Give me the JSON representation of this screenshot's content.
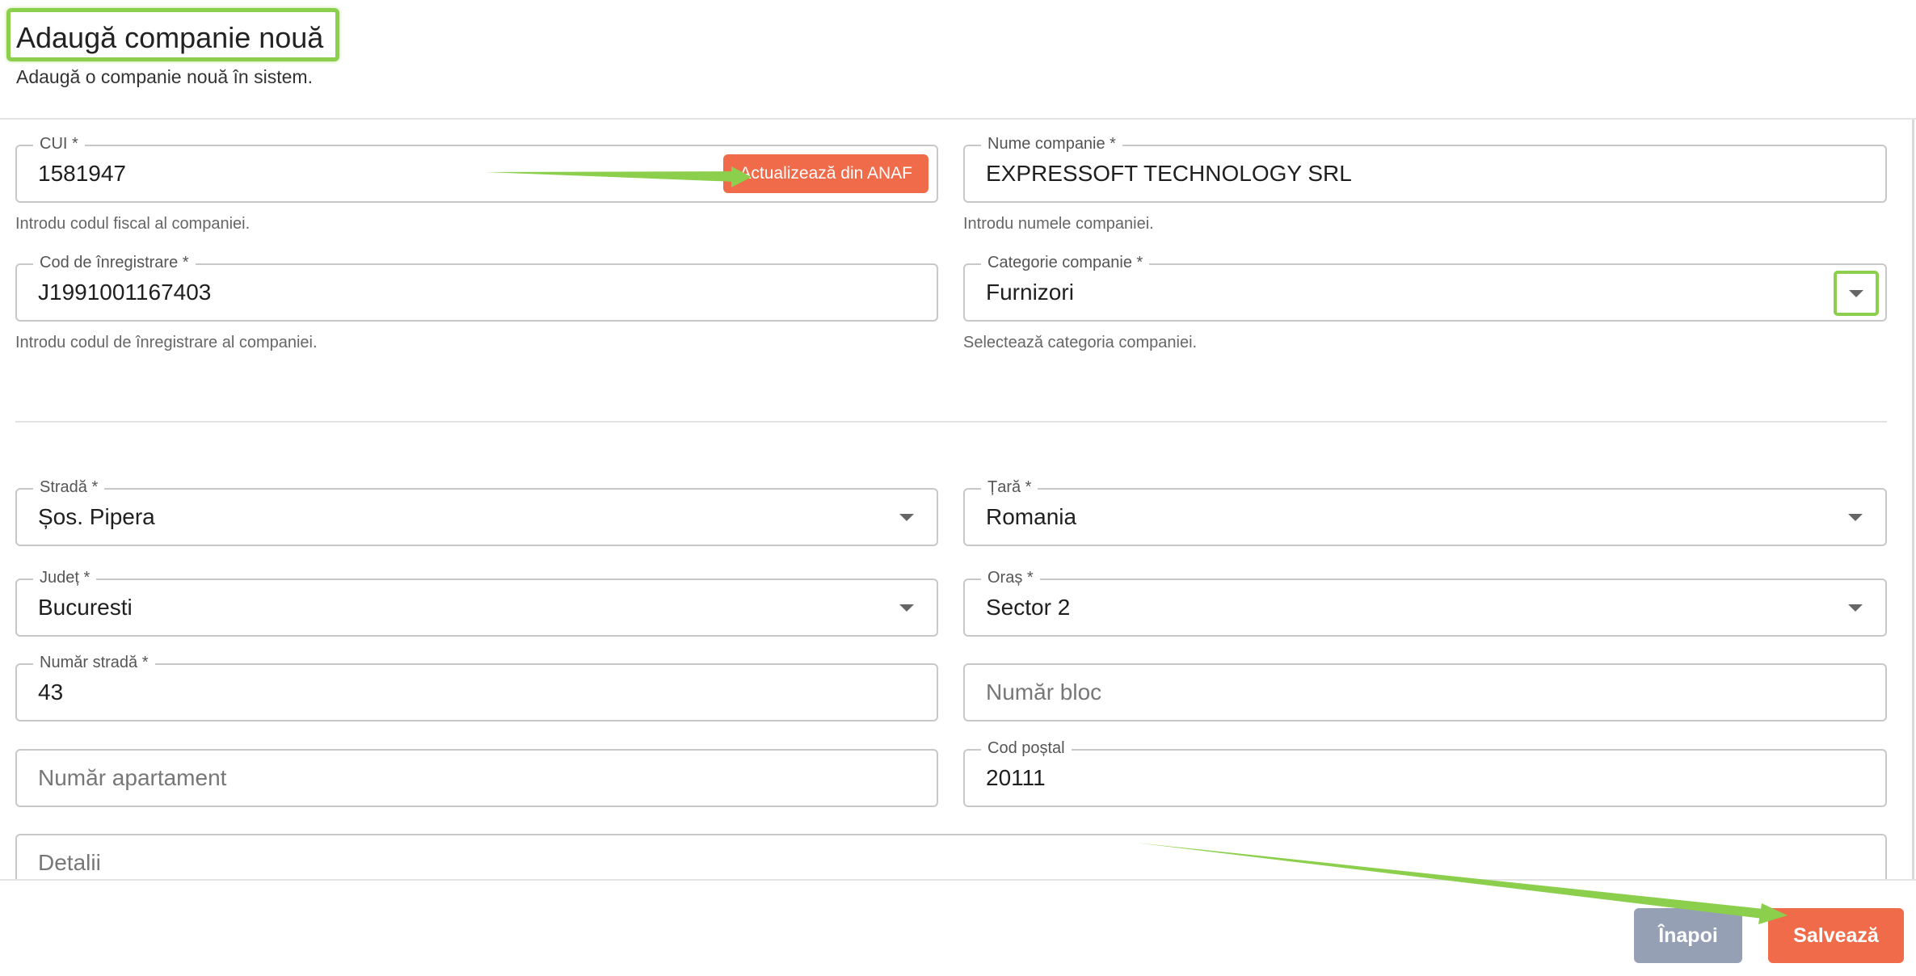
{
  "header": {
    "title": "Adaugă companie nouă",
    "subtitle": "Adaugă o companie nouă în sistem."
  },
  "company": {
    "cui": {
      "label": "CUI *",
      "value": "1581947",
      "helper": "Introdu codul fiscal al companiei.",
      "action_label": "Actualizează din ANAF"
    },
    "name": {
      "label": "Nume companie *",
      "value": "EXPRESSOFT TECHNOLOGY SRL",
      "helper": "Introdu numele companiei."
    },
    "reg_code": {
      "label": "Cod de înregistrare *",
      "value": "J1991001167403",
      "helper": "Introdu codul de înregistrare al companiei."
    },
    "category": {
      "label": "Categorie companie *",
      "value": "Furnizori",
      "helper": "Selectează categoria companiei."
    }
  },
  "address": {
    "street": {
      "label": "Stradă *",
      "value": "Șos. Pipera"
    },
    "country": {
      "label": "Țară *",
      "value": "Romania"
    },
    "county": {
      "label": "Județ *",
      "value": "Bucuresti"
    },
    "city": {
      "label": "Oraș *",
      "value": "Sector 2"
    },
    "street_number": {
      "label": "Număr stradă *",
      "value": "43"
    },
    "block_number": {
      "placeholder": "Număr bloc"
    },
    "apartment_number": {
      "placeholder": "Număr apartament"
    },
    "postal_code": {
      "label": "Cod poștal",
      "value": "20111"
    },
    "details": {
      "placeholder": "Detalii"
    }
  },
  "footer": {
    "back_label": "Înapoi",
    "save_label": "Salvează"
  },
  "colors": {
    "accent": "#ef6b4a",
    "secondary_button": "#96a0b5",
    "highlight": "#8ccf4d"
  }
}
